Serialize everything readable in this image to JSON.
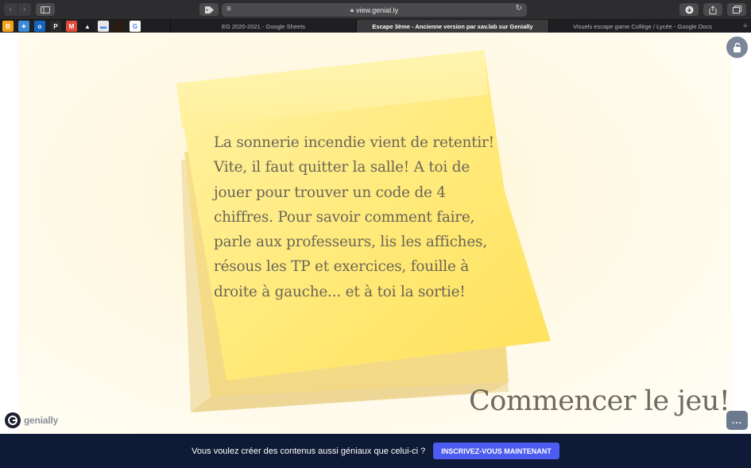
{
  "browser": {
    "url": "view.genial.ly",
    "tabs": [
      {
        "label": "EG 2020-2021 - Google Sheets",
        "active": false
      },
      {
        "label": "Escape 3ème - Ancienne version par xav.lab sur Genially",
        "active": true
      },
      {
        "label": "Visuels escape game Collège / Lycée - Google Docs",
        "active": false
      }
    ],
    "new_tab_label": "+",
    "favorites": [
      {
        "icon": "bookmark-orange-icon",
        "color": "#f7a21b",
        "glyph": "B"
      },
      {
        "icon": "twitter-bird-icon",
        "color": "#3a8ad6",
        "glyph": "✦"
      },
      {
        "icon": "outlook-icon",
        "color": "#1565c0",
        "glyph": "o"
      },
      {
        "icon": "pix-icon",
        "color": "#2b2b2b",
        "glyph": "P"
      },
      {
        "icon": "gmail-icon",
        "color": "#e14b3b",
        "glyph": "M"
      },
      {
        "icon": "google-drive-icon",
        "color": "#1c1c1e",
        "glyph": "▲"
      },
      {
        "icon": "page-icon",
        "color": "#e6e6e6",
        "glyph": "▬"
      },
      {
        "icon": "dark-square-icon",
        "color": "#2a1a12",
        "glyph": ""
      },
      {
        "icon": "google-icon",
        "color": "#ffffff",
        "glyph": "G"
      }
    ]
  },
  "slide": {
    "note_text": "La sonnerie incendie vient de retentir! Vite, il faut quitter la salle! A toi de jouer pour trouver un code de 4 chiffres. Pour savoir comment faire, parle aux professeurs, lis les affiches, résous les TP et exercices, fouille à droite à gauche... et à toi la sortie!",
    "start_button_label": "Commencer le jeu!",
    "brand_label": "genially",
    "more_label": "..."
  },
  "banner": {
    "text": "Vous voulez créer des contenus aussi géniaux que celui-ci ?",
    "cta_label": "Inscrivez-vous maintenant"
  },
  "colors": {
    "note_main": "#ffe77a",
    "note_back": "#f7dc82",
    "note_shadow": "#efd8a0",
    "banner_bg": "#0f1a36",
    "cta_bg": "#4c5bf0"
  }
}
